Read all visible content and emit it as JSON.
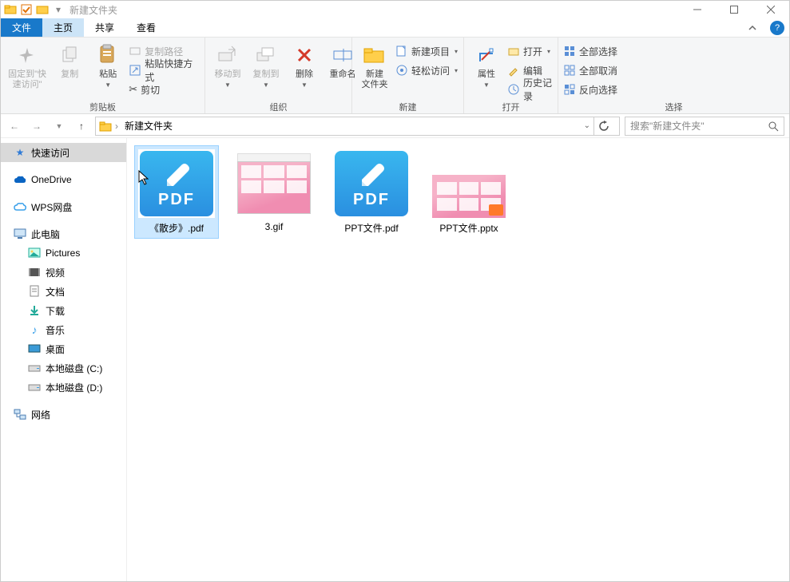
{
  "window": {
    "title": "新建文件夹"
  },
  "tabs": {
    "file": "文件",
    "home": "主页",
    "share": "共享",
    "view": "查看"
  },
  "ribbon": {
    "clipboard": {
      "pin": "固定到\"快\n速访问\"",
      "copy": "复制",
      "paste": "粘贴",
      "copy_path": "复制路径",
      "paste_shortcut": "粘贴快捷方式",
      "cut": "剪切",
      "label": "剪贴板"
    },
    "organize": {
      "move_to": "移动到",
      "copy_to": "复制到",
      "delete": "删除",
      "rename": "重命名",
      "label": "组织"
    },
    "new": {
      "new_folder": "新建\n文件夹",
      "new_item": "新建项目",
      "easy_access": "轻松访问",
      "label": "新建"
    },
    "open": {
      "properties": "属性",
      "open": "打开",
      "edit": "编辑",
      "history": "历史记录",
      "label": "打开"
    },
    "select": {
      "select_all": "全部选择",
      "select_none": "全部取消",
      "invert": "反向选择",
      "label": "选择"
    }
  },
  "breadcrumb": {
    "seg1": "新建文件夹"
  },
  "search": {
    "placeholder": "搜索\"新建文件夹\""
  },
  "sidebar": {
    "quick_access": "快速访问",
    "onedrive": "OneDrive",
    "wps": "WPS网盘",
    "this_pc": "此电脑",
    "pictures": "Pictures",
    "videos": "视频",
    "documents": "文档",
    "downloads": "下载",
    "music": "音乐",
    "desktop": "桌面",
    "disk_c": "本地磁盘 (C:)",
    "disk_d": "本地磁盘 (D:)",
    "network": "网络"
  },
  "files": [
    {
      "name": "《散步》.pdf",
      "type": "pdf",
      "selected": true
    },
    {
      "name": "3.gif",
      "type": "gif",
      "selected": false
    },
    {
      "name": "PPT文件.pdf",
      "type": "pdf",
      "selected": false
    },
    {
      "name": "PPT文件.pptx",
      "type": "pptx",
      "selected": false
    }
  ],
  "glyphs": {
    "pdf_label": "PDF"
  }
}
